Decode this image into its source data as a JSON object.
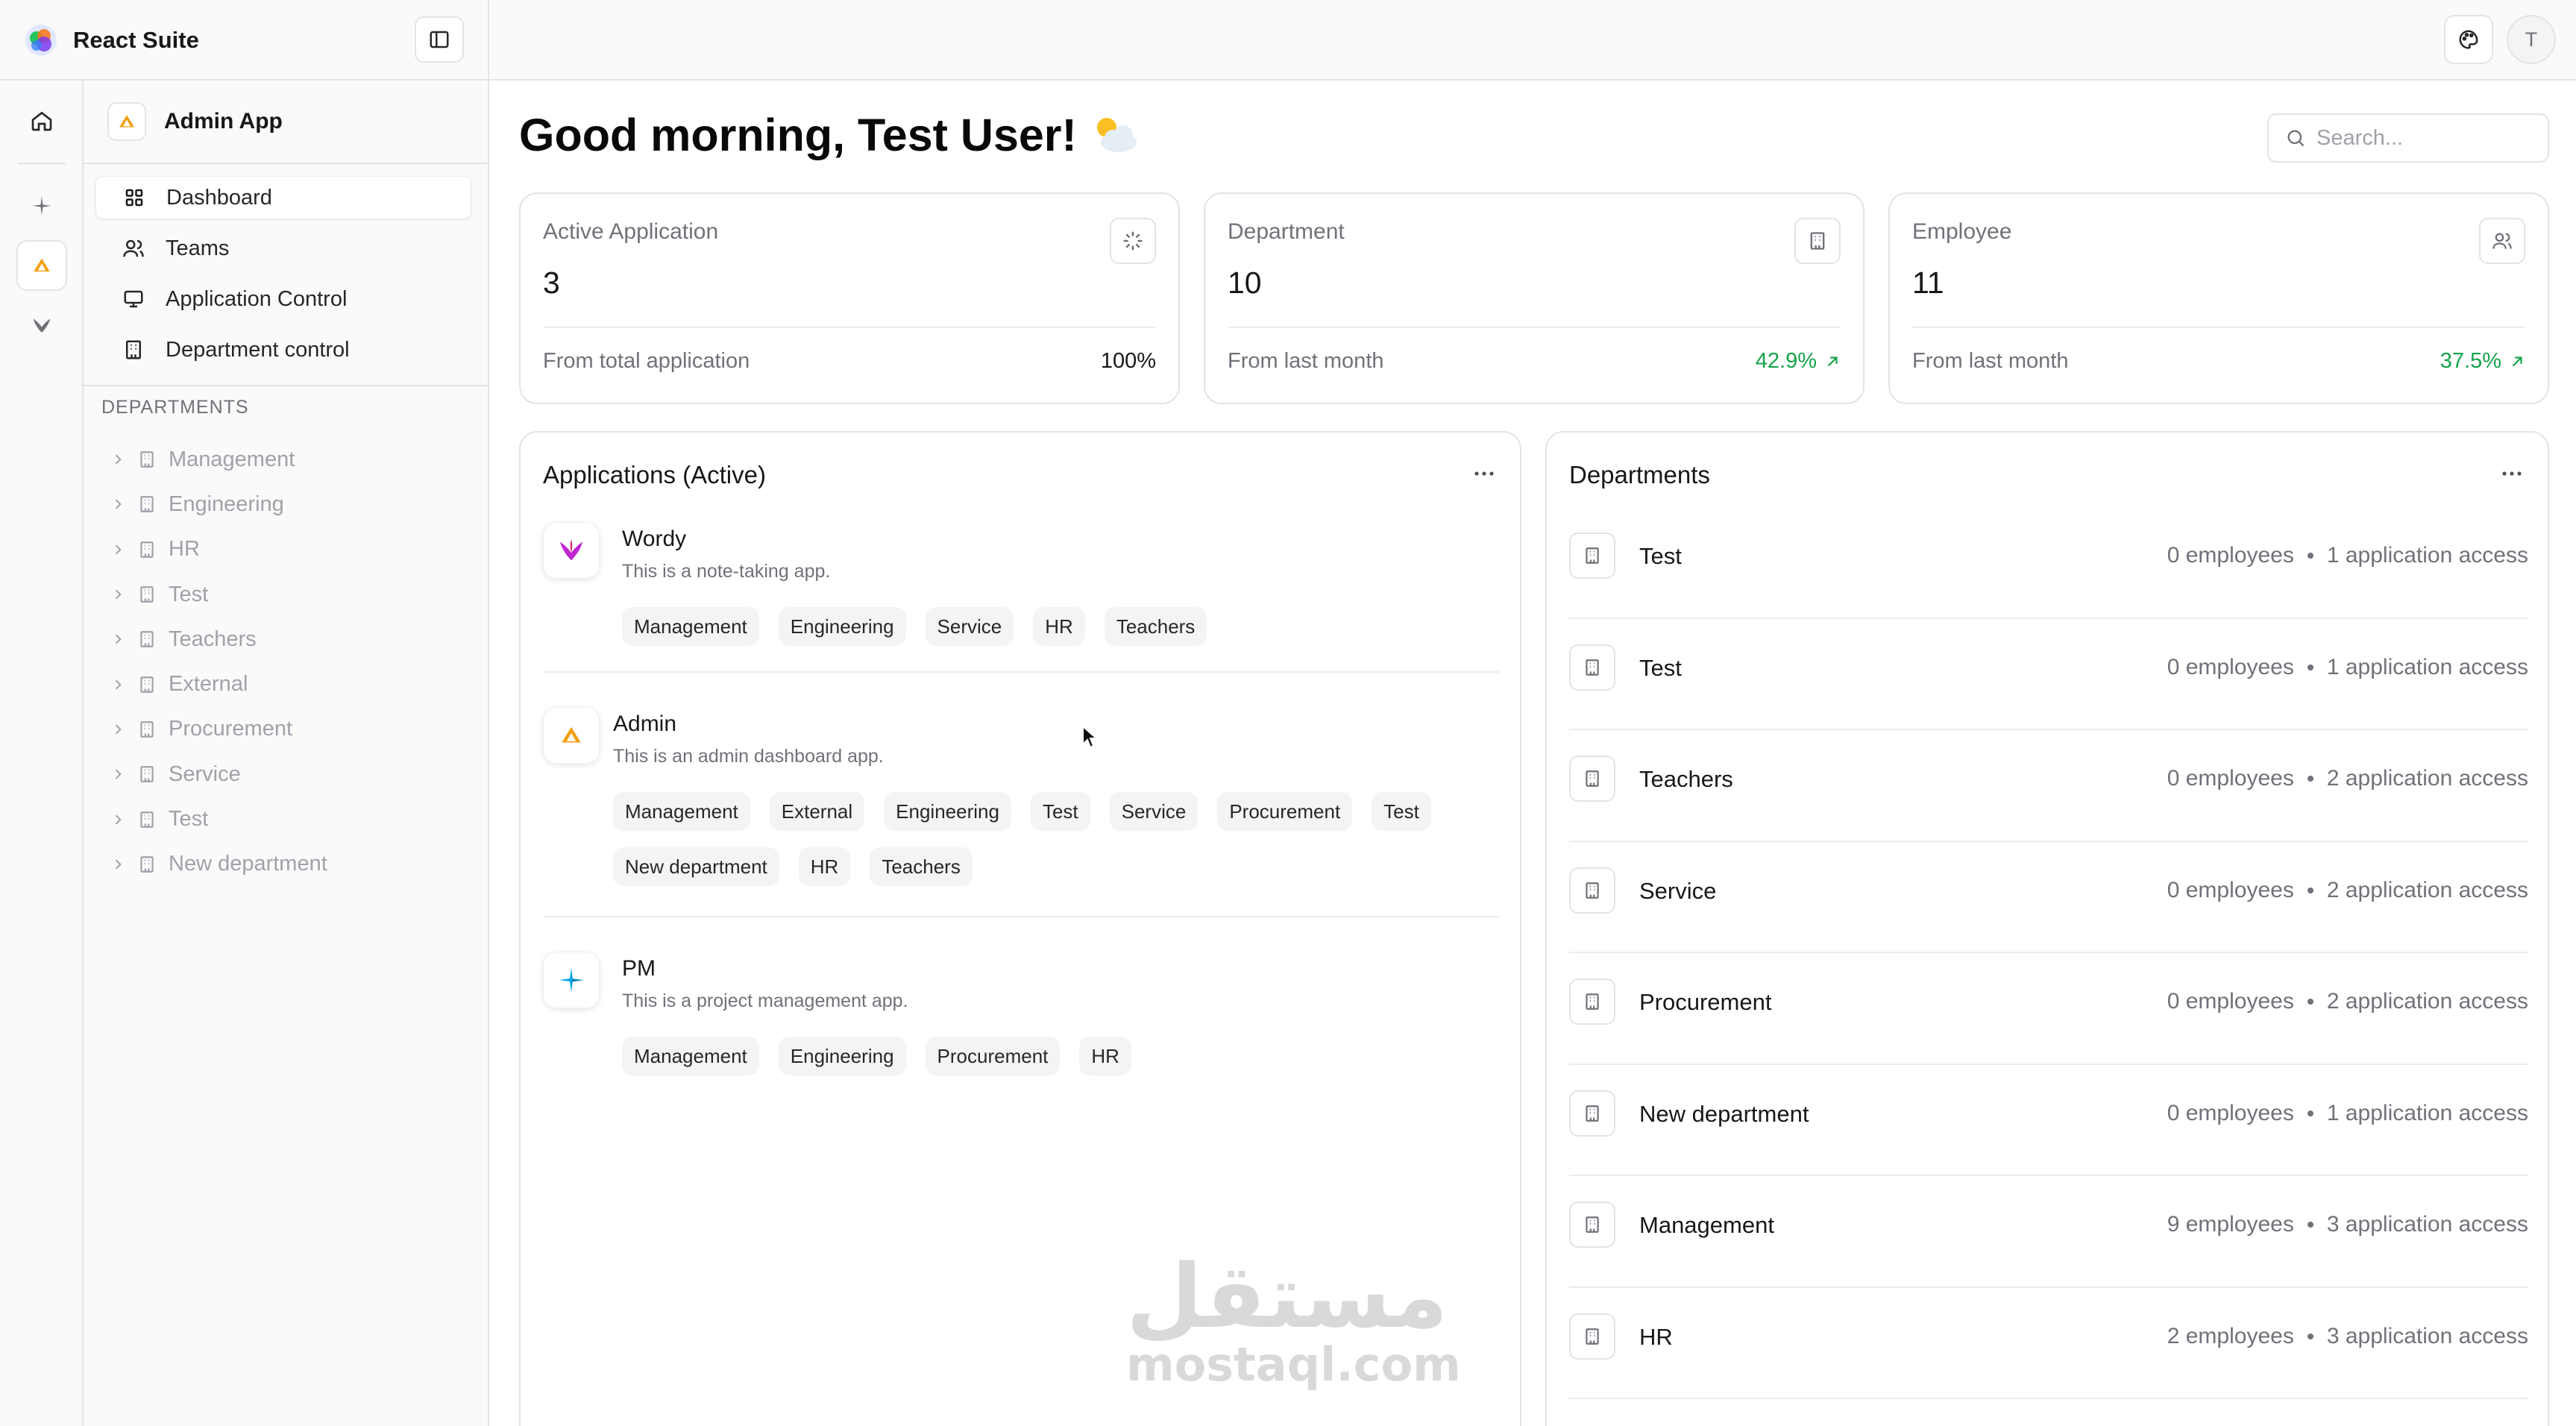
{
  "topbar": {
    "brand": "React Suite",
    "avatar_initial": "T"
  },
  "rail": {
    "items": [
      {
        "name": "home"
      },
      {
        "name": "pm-app"
      },
      {
        "name": "admin-app",
        "active": true
      },
      {
        "name": "wordy-app"
      }
    ]
  },
  "sidebar": {
    "app_name": "Admin App",
    "nav": [
      {
        "label": "Dashboard",
        "icon": "grid-icon",
        "active": true
      },
      {
        "label": "Teams",
        "icon": "users-icon"
      },
      {
        "label": "Application Control",
        "icon": "monitor-icon"
      },
      {
        "label": "Department control",
        "icon": "building-icon"
      }
    ],
    "departments_heading": "DEPARTMENTS",
    "departments": [
      "Management",
      "Engineering",
      "HR",
      "Test",
      "Teachers",
      "External",
      "Procurement",
      "Service",
      "Test",
      "New department"
    ]
  },
  "main": {
    "greeting": "Good morning, Test User!",
    "greeting_emoji": "⛅",
    "search_placeholder": "Search...",
    "stats": [
      {
        "label": "Active Application",
        "value": "3",
        "footer_label": "From total application",
        "footer_value": "100%",
        "trend_up": false,
        "icon": "loader-icon"
      },
      {
        "label": "Department",
        "value": "10",
        "footer_label": "From last month",
        "footer_value": "42.9%",
        "trend_up": true,
        "icon": "building-icon"
      },
      {
        "label": "Employee",
        "value": "11",
        "footer_label": "From last month",
        "footer_value": "37.5%",
        "trend_up": true,
        "icon": "users-icon"
      }
    ],
    "applications_panel": {
      "title": "Applications (Active)",
      "apps": [
        {
          "name": "Wordy",
          "description": "This is a note-taking app.",
          "departments": [
            "Management",
            "Engineering",
            "Service",
            "HR",
            "Teachers"
          ]
        },
        {
          "name": "Admin",
          "description": "This is an admin dashboard app.",
          "departments": [
            "Management",
            "External",
            "Engineering",
            "Test",
            "Service",
            "Procurement",
            "Test",
            "New department",
            "HR",
            "Teachers"
          ]
        },
        {
          "name": "PM",
          "description": "This is a project management app.",
          "departments": [
            "Management",
            "Engineering",
            "Procurement",
            "HR"
          ]
        }
      ]
    },
    "departments_panel": {
      "title": "Departments",
      "rows": [
        {
          "name": "Test",
          "employees": "0 employees",
          "access": "1 application access"
        },
        {
          "name": "Test",
          "employees": "0 employees",
          "access": "1 application access"
        },
        {
          "name": "Teachers",
          "employees": "0 employees",
          "access": "2 application access"
        },
        {
          "name": "Service",
          "employees": "0 employees",
          "access": "2 application access"
        },
        {
          "name": "Procurement",
          "employees": "0 employees",
          "access": "2 application access"
        },
        {
          "name": "New department",
          "employees": "0 employees",
          "access": "1 application access"
        },
        {
          "name": "Management",
          "employees": "9 employees",
          "access": "3 application access"
        },
        {
          "name": "HR",
          "employees": "2 employees",
          "access": "3 application access"
        }
      ]
    }
  },
  "watermark": {
    "arabic": "مستقل",
    "latin": "mostaql.com"
  },
  "colors": {
    "accent_orange": "#f59e0b",
    "trend_green": "#16a34a",
    "wordy_pink": "#c026d3",
    "pm_blue": "#0ea5e9"
  }
}
